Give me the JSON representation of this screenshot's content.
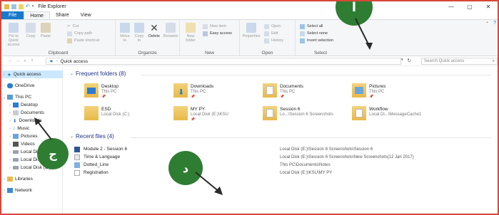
{
  "window": {
    "title": "File Explorer",
    "controls": {
      "minimize": "—",
      "maximize": "▢",
      "close": "✕"
    }
  },
  "tabs": [
    "File",
    "Home",
    "Share",
    "View"
  ],
  "ribbon": {
    "clipboard": {
      "label": "Clipboard",
      "pin": "Pin to Quick access",
      "copy": "Copy",
      "paste": "Paste",
      "cut": "Cut",
      "copy_path": "Copy path",
      "paste_shortcut": "Paste shortcut"
    },
    "organize": {
      "label": "Organize",
      "move_to": "Move to",
      "copy_to": "Copy to",
      "delete": "Delete",
      "rename": "Rename"
    },
    "new": {
      "label": "New",
      "new_folder": "New folder",
      "new_item": "New item",
      "easy_access": "Easy access"
    },
    "open": {
      "label": "Open",
      "properties": "Properties",
      "open": "Open",
      "edit": "Edit",
      "history": "History"
    },
    "select": {
      "label": "Select",
      "select_all": "Select all",
      "select_none": "Select none",
      "invert": "Invert selection"
    }
  },
  "address": {
    "path": "Quick access",
    "search_placeholder": "Search Quick access"
  },
  "nav": [
    {
      "label": "Quick access",
      "icon": "star-icon",
      "selected": true
    },
    {
      "label": "OneDrive",
      "icon": "cloud-icon"
    },
    {
      "label": "This PC",
      "icon": "computer-icon"
    },
    {
      "label": "Desktop",
      "icon": "desktop-icon"
    },
    {
      "label": "Documents",
      "icon": "documents-icon"
    },
    {
      "label": "Downloads",
      "icon": "downloads-icon"
    },
    {
      "label": "Music",
      "icon": "music-icon"
    },
    {
      "label": "Pictures",
      "icon": "pictures-icon"
    },
    {
      "label": "Videos",
      "icon": "videos-icon"
    },
    {
      "label": "Local Disk (C:)",
      "icon": "drive-icon"
    },
    {
      "label": "Local Disk (D:)",
      "icon": "drive-icon"
    },
    {
      "label": "Local Disk (E:)",
      "icon": "drive-icon"
    },
    {
      "label": "Libraries",
      "icon": "libraries-icon"
    },
    {
      "label": "Network",
      "icon": "network-icon"
    }
  ],
  "frequent": {
    "heading": "Frequent folders (8)",
    "folders": [
      {
        "name": "Desktop",
        "sub": "This PC"
      },
      {
        "name": "Downloads",
        "sub": "This PC"
      },
      {
        "name": "Documents",
        "sub": "This PC"
      },
      {
        "name": "Pictures",
        "sub": "This PC"
      },
      {
        "name": "ESD",
        "sub": "Local Disk (C:)"
      },
      {
        "name": "MY PY",
        "sub": "Local Disk (E:)\\KSU"
      },
      {
        "name": "Session 6",
        "sub": "Lo...\\Session 6 Screenshots"
      },
      {
        "name": "Workflow",
        "sub": "Local Di...\\MessageCache1"
      }
    ]
  },
  "recent": {
    "heading": "Recent files (4)",
    "files": [
      {
        "name": "Module 2 - Session 6",
        "path": "Local Disk (E:)\\Session 6 Screenshots\\Session 6"
      },
      {
        "name": "Time & Language",
        "path": "Local Disk (E:)\\Session 6 Screenshots\\New Screenshots(12 Jan 2017)"
      },
      {
        "name": "Dotted_Line",
        "path": "This PC\\Documents\\Notes"
      },
      {
        "name": "Registration",
        "path": "Local Disk (E:)\\KSU\\MY PY"
      }
    ]
  },
  "annotations": {
    "a": "أ",
    "b": "ج",
    "c": "د"
  },
  "colors": {
    "accent": "#1979ca",
    "frame": "#d9463b",
    "badge": "#2e7d32",
    "selected": "#cce8ff",
    "heading": "#1e3287"
  }
}
